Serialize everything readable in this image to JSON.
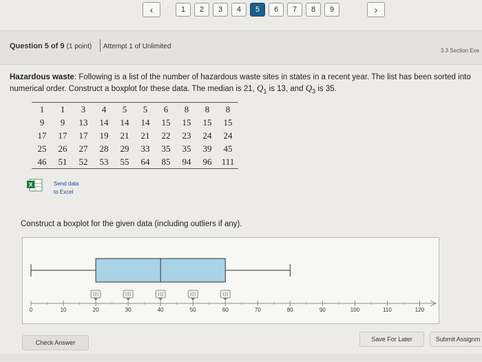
{
  "nav": {
    "pages": [
      "1",
      "2",
      "3",
      "4",
      "5",
      "6",
      "7",
      "8",
      "9"
    ],
    "active_index": 4,
    "prev_icon": "chevron-left-icon",
    "next_icon": "chevron-right-icon"
  },
  "question_header": {
    "title": "Question 5 of 9",
    "points": "(1 point)",
    "attempt": "Attempt 1 of Unlimited",
    "section": "3.3 Section Exe"
  },
  "problem": {
    "lead": "Hazardous waste",
    "text_1": ": Following is a list of the number of hazardous waste sites in states in a recent year. The list has been sorted into numerical order. Construct a boxplot for these data. The median is 21, ",
    "q1_sym": "Q",
    "q1_sub": "1",
    "text_2": " is 13, and ",
    "q3_sym": "Q",
    "q3_sub": "3",
    "text_3": " is 35."
  },
  "data_table": [
    [
      "1",
      "1",
      "3",
      "4",
      "5",
      "5",
      "6",
      "8",
      "8",
      "8"
    ],
    [
      "9",
      "9",
      "13",
      "14",
      "14",
      "14",
      "15",
      "15",
      "15",
      "15"
    ],
    [
      "17",
      "17",
      "17",
      "19",
      "21",
      "21",
      "22",
      "23",
      "24",
      "24"
    ],
    [
      "25",
      "26",
      "27",
      "28",
      "29",
      "33",
      "35",
      "35",
      "39",
      "45"
    ],
    [
      "46",
      "51",
      "52",
      "53",
      "55",
      "64",
      "85",
      "94",
      "96",
      "111"
    ]
  ],
  "excel": {
    "label_1": "Send data",
    "label_2": "to Excel",
    "icon": "excel-icon"
  },
  "construct_prompt": "Construct a boxplot for the given data (including outliers if any).",
  "chart_data": {
    "type": "boxplot",
    "axis_ticks": [
      "0",
      "10",
      "20",
      "30",
      "40",
      "50",
      "60",
      "70",
      "80",
      "90",
      "100",
      "110",
      "120"
    ],
    "xlim": [
      0,
      125
    ],
    "box": {
      "whisker_low": 0,
      "q1": 20,
      "median": 40,
      "q3": 60,
      "whisker_high": 80
    },
    "handles": [
      20,
      30,
      40,
      50,
      60
    ]
  },
  "colors": {
    "box_fill": "#a9d3e6",
    "box_stroke": "#333333",
    "accent": "#1a5e8a"
  },
  "buttons": {
    "check": "Check Answer",
    "save": "Save For Later",
    "submit": "Submit Assignm"
  }
}
